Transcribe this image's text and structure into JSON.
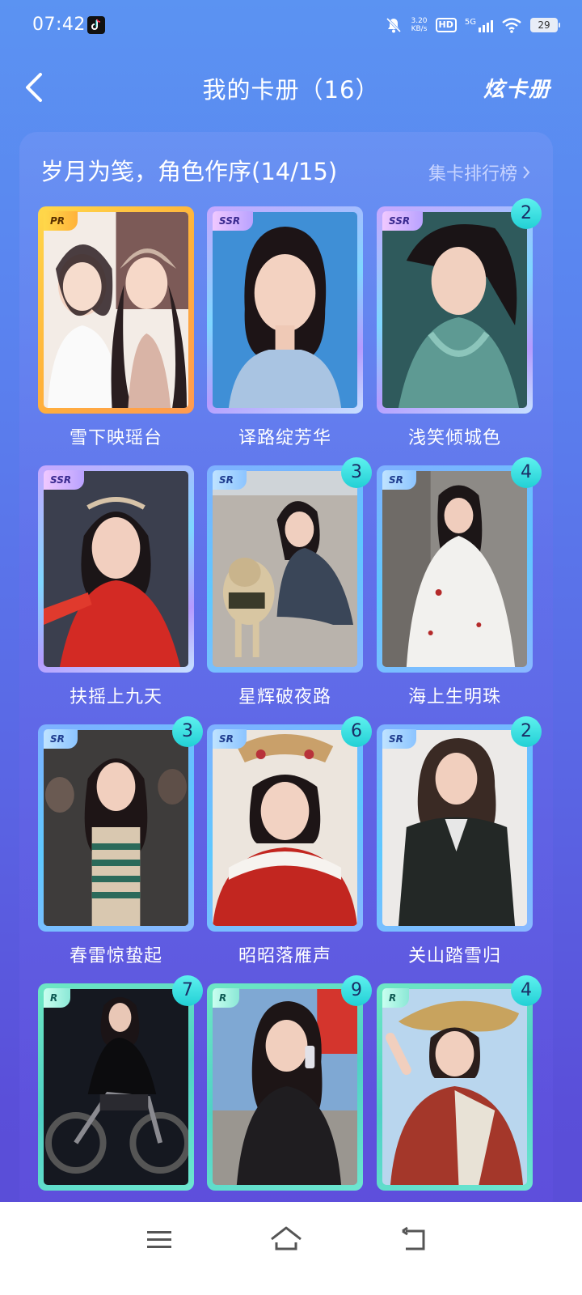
{
  "status_bar": {
    "time": "07:42",
    "net_speed_value": "3.20",
    "net_speed_unit": "KB/s",
    "hd_label": "HD",
    "network_label": "5G",
    "battery": "29",
    "icons": [
      "tiktok-icon",
      "mute-icon",
      "signal-icon",
      "wifi-icon",
      "battery-icon"
    ]
  },
  "header": {
    "title": "我的卡册（16）",
    "right_action": "炫卡册"
  },
  "section": {
    "title": "岁月为笺，角色作序(14/15)",
    "ranking_link": "集卡排行榜"
  },
  "cards": [
    {
      "name": "雪下映瑶台",
      "rarity": "PR",
      "count": ""
    },
    {
      "name": "译路绽芳华",
      "rarity": "SSR",
      "count": ""
    },
    {
      "name": "浅笑倾城色",
      "rarity": "SSR",
      "count": "2"
    },
    {
      "name": "扶摇上九天",
      "rarity": "SSR",
      "count": ""
    },
    {
      "name": "星辉破夜路",
      "rarity": "SR",
      "count": "3"
    },
    {
      "name": "海上生明珠",
      "rarity": "SR",
      "count": "4"
    },
    {
      "name": "春雷惊蛰起",
      "rarity": "SR",
      "count": "3"
    },
    {
      "name": "昭昭落雁声",
      "rarity": "SR",
      "count": "6"
    },
    {
      "name": "关山踏雪归",
      "rarity": "SR",
      "count": "2"
    },
    {
      "name": "",
      "rarity": "R",
      "count": "7"
    },
    {
      "name": "",
      "rarity": "R",
      "count": "9"
    },
    {
      "name": "",
      "rarity": "R",
      "count": "4"
    }
  ],
  "colors": {
    "badge": "#2fd9dc",
    "pr_frame": "#ffc445",
    "ssr_frame": "#b59bff",
    "sr_frame": "#6cc2ff",
    "r_frame": "#5fdcc6"
  },
  "nav_bar": {
    "icons": [
      "menu-icon",
      "home-icon",
      "back-icon"
    ]
  }
}
